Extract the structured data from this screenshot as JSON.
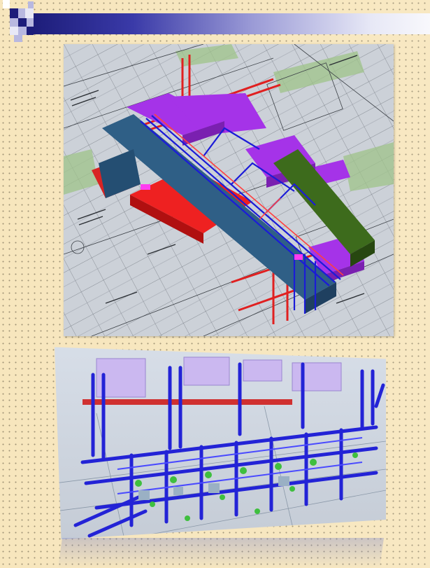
{
  "slide": {
    "background_color": "#f7e6bd",
    "header_colors": {
      "dark": "#1d1d7a",
      "light": "#f8f8fc"
    }
  },
  "top_render": {
    "kind": "3d-mep-duct-render-over-floorplan",
    "duct_colors": {
      "purple": "#a533e8",
      "blue": "#2f5f86",
      "red": "#ee2121",
      "green": "#3d6b1c",
      "pipe_blue": "#1b1bd8"
    }
  },
  "bottom_render": {
    "kind": "3d-piping-render-perspective",
    "pipe_colors": {
      "blue": "#2323d6",
      "green": "#3fbf3f",
      "lavender": "#c8b4f0",
      "red": "#d03030"
    }
  }
}
